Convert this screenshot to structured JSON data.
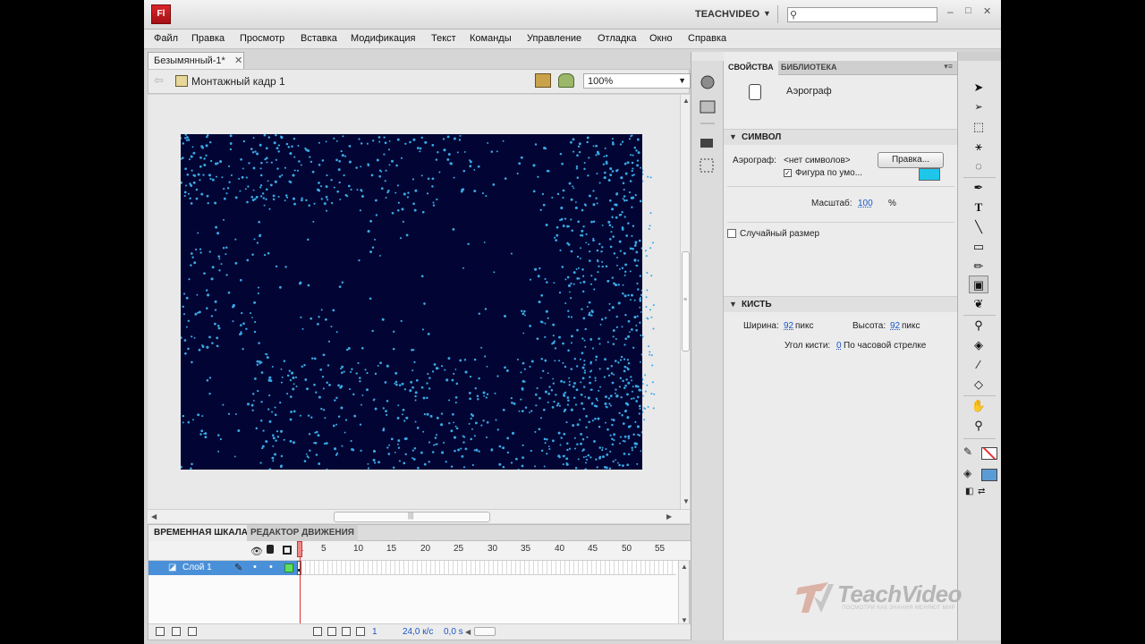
{
  "app": {
    "logo": "Fl",
    "workspace": "TEACHVIDEO",
    "search_placeholder": ""
  },
  "window_controls": {
    "minimize": "–",
    "maximize": "□",
    "close": "✕"
  },
  "menu": [
    "Файл",
    "Правка",
    "Просмотр",
    "Вставка",
    "Модификация",
    "Текст",
    "Команды",
    "Управление",
    "Отладка",
    "Окно",
    "Справка"
  ],
  "document": {
    "tab_title": "Безымянный-1*",
    "scene": "Монтажный кадр 1",
    "zoom": "100%"
  },
  "stage": {
    "background": "#020533",
    "particle_color": "#3aa8e6"
  },
  "timeline": {
    "tabs": [
      "ВРЕМЕННАЯ ШКАЛА",
      "РЕДАКТОР ДВИЖЕНИЯ"
    ],
    "ruler": [
      "1",
      "5",
      "10",
      "15",
      "20",
      "25",
      "30",
      "35",
      "40",
      "45",
      "50",
      "55"
    ],
    "layer": {
      "name": "Слой 1",
      "color": "#5ee05e"
    },
    "footer": {
      "frame": "1",
      "fps": "24,0 к/с",
      "time": "0,0 s"
    }
  },
  "properties": {
    "tabs": [
      "СВОЙСТВА",
      "БИБЛИОТЕКА"
    ],
    "tool_name": "Аэрограф",
    "symbol_section": {
      "title": "СИМВОЛ",
      "airbrush_label": "Аэрограф:",
      "airbrush_value": "<нет символов>",
      "edit_button": "Правка...",
      "default_shape_label": "Фигура по умо...",
      "default_shape_checked": true,
      "swatch_color": "#1ec6ea",
      "scale_label": "Масштаб:",
      "scale_value": "100",
      "scale_unit": "%",
      "random_size_label": "Случайный размер",
      "random_size_checked": false
    },
    "brush_section": {
      "title": "КИСТЬ",
      "width_label": "Ширина:",
      "width_value": "92",
      "width_unit": "пикс",
      "height_label": "Высота:",
      "height_value": "92",
      "height_unit": "пикс",
      "angle_label": "Угол кисти:",
      "angle_value": "0",
      "angle_unit": "По часовой стрелке"
    }
  },
  "toolbar": {
    "tools": [
      "selection-tool",
      "subselection-tool",
      "free-transform-tool",
      "3d-rotation-tool",
      "lasso-tool",
      "pen-tool",
      "text-tool",
      "line-tool",
      "rectangle-tool",
      "pencil-tool",
      "spray-brush-tool",
      "deco-tool",
      "bone-tool",
      "paint-bucket-tool",
      "eyedropper-tool",
      "eraser-tool",
      "hand-tool",
      "zoom-tool"
    ],
    "stroke_color": "none",
    "fill_color": "#5b9bd5"
  },
  "watermark": {
    "brand": "TeachVideo",
    "slogan": "ПОСМОТРИ КАК ЗНАНИЯ МЕНЯЮТ МИР"
  }
}
